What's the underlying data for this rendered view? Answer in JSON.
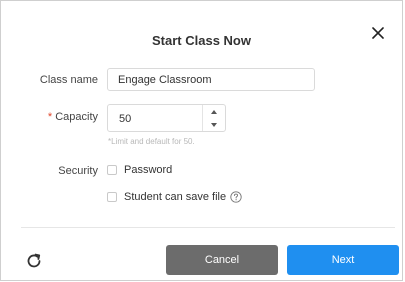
{
  "dialog": {
    "title": "Start Class Now",
    "close_icon": "close-icon"
  },
  "form": {
    "class_name": {
      "label": "Class name",
      "value": "Engage Classroom"
    },
    "capacity": {
      "required_mark": "*",
      "label": "Capacity",
      "value": "50",
      "hint": "*Limit and default for 50."
    },
    "security": {
      "label": "Security",
      "options": [
        {
          "label": "Password",
          "checked": false
        },
        {
          "label": "Student can save file",
          "checked": false
        }
      ],
      "help_icon": "question-circle-icon"
    }
  },
  "footer": {
    "refresh_icon": "refresh-icon",
    "cancel_label": "Cancel",
    "next_label": "Next"
  },
  "colors": {
    "primary": "#1f8ff0",
    "secondary": "#6c6c6c",
    "required": "#e0442a"
  }
}
